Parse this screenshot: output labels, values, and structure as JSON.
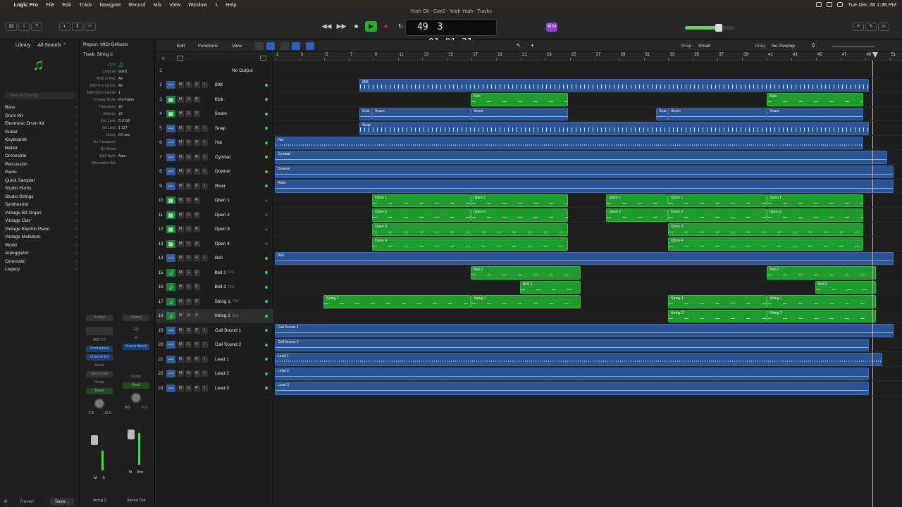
{
  "menubar": {
    "app": "Logic Pro",
    "items": [
      "File",
      "Edit",
      "Track",
      "Navigate",
      "Record",
      "Mix",
      "View",
      "Window",
      "1",
      "Help"
    ],
    "clock": "Tue Dec 28  1:36 PM"
  },
  "window": {
    "title": "Yeah Ok - Cue2 - Yeah Yeah - Tracks"
  },
  "lcd": {
    "bar": "49",
    "beat": "3",
    "time": "01:01:31",
    "sub": ""
  },
  "toolbar": {
    "badge": "⌘34"
  },
  "library": {
    "label": "Library",
    "filter": "All Sounds ⌃",
    "search_placeholder": "Search Sounds",
    "items": [
      "Bass",
      "Drum Kit",
      "Electronic Drum Kit",
      "Guitar",
      "Keyboards",
      "Mallet",
      "Orchestral",
      "Percussion",
      "Piano",
      "Quick Sampler",
      "Studio Horns",
      "Studio Strings",
      "Synthesizer",
      "Vintage B3 Organ",
      "Vintage Clav",
      "Vintage Electric Piano",
      "Vintage Mellotron",
      "World",
      "Arpeggiator",
      "Cinematic",
      "Legacy"
    ],
    "revert": "Revert",
    "save": "Save..."
  },
  "inspector": {
    "region": "Region:  MIDI Defaults",
    "track": "Track:  String 2",
    "icon_label": "Icon:",
    "rows": [
      {
        "l": "Channel:",
        "v": "Inst 8"
      },
      {
        "l": "MIDI In Port:",
        "v": "All"
      },
      {
        "l": "MIDI In Channel:",
        "v": "All"
      },
      {
        "l": "MIDI Out Channel:",
        "v": "1"
      },
      {
        "l": "Freeze Mode:",
        "v": "Pre Fader"
      },
      {
        "l": "Transpose:",
        "v": "±0"
      },
      {
        "l": "Velocity:",
        "v": "±0"
      },
      {
        "l": "Key Limit:",
        "v": "C-2  G8"
      },
      {
        "l": "Vel Limit:",
        "v": "1  127"
      },
      {
        "l": "Delay:",
        "v": "0.0 sec"
      },
      {
        "l": "No Transpose:",
        "v": ""
      },
      {
        "l": "No Reset:",
        "v": ""
      },
      {
        "l": "Staff Style:",
        "v": "Auto"
      },
      {
        "l": "Articulation Set:",
        "v": ""
      }
    ],
    "strip1": {
      "setting": "Setting",
      "plugin": "Omnisphere",
      "eq": "Channel EQ",
      "sends": "Sends",
      "out": "Stereo Out",
      "group": "Group",
      "read": "Read",
      "vol": "-7.0",
      "peak": "-12.9",
      "label": "String 2",
      "midi": "MIDI FX"
    },
    "strip2": {
      "setting": "Setting",
      "plugin": "Smack Attack",
      "eq": "EQ",
      "out": "",
      "group": "Group",
      "read": "Read",
      "vol": "0.0",
      "peak": "-0.1",
      "label": "Stereo Out",
      "bnc": "Bnc"
    }
  },
  "tracks_header": {
    "edit": "Edit",
    "functions": "Functions",
    "view": "View",
    "snap_label": "Snap:",
    "snap": "Smart",
    "drag_label": "Drag:",
    "drag": "No Overlap"
  },
  "ruler": {
    "bars": [
      "1",
      "3",
      "5",
      "7",
      "9",
      "11",
      "13",
      "15",
      "17",
      "19",
      "21",
      "23",
      "25",
      "27",
      "29",
      "31",
      "33",
      "35",
      "37",
      "39",
      "41",
      "43",
      "45",
      "47",
      "49",
      "51"
    ]
  },
  "tracks": [
    {
      "n": "1",
      "name": "No Output",
      "kind": "none"
    },
    {
      "n": "2",
      "name": "808",
      "kind": "audio"
    },
    {
      "n": "3",
      "name": "Kick",
      "kind": "drum"
    },
    {
      "n": "4",
      "name": "Snare",
      "kind": "drum"
    },
    {
      "n": "5",
      "name": "Snap",
      "kind": "audio"
    },
    {
      "n": "6",
      "name": "Hat",
      "kind": "audio"
    },
    {
      "n": "7",
      "name": "Cymbal",
      "kind": "audio"
    },
    {
      "n": "8",
      "name": "Downer",
      "kind": "audio"
    },
    {
      "n": "9",
      "name": "Riser",
      "kind": "audio"
    },
    {
      "n": "10",
      "name": "Open 1",
      "kind": "drum"
    },
    {
      "n": "11",
      "name": "Open 2",
      "kind": "drum"
    },
    {
      "n": "12",
      "name": "Open 3",
      "kind": "drum"
    },
    {
      "n": "13",
      "name": "Open 4",
      "kind": "drum"
    },
    {
      "n": "14",
      "name": "Bell",
      "kind": "audio"
    },
    {
      "n": "15",
      "name": "Bell 2",
      "kind": "inst",
      "ch": "Ch1"
    },
    {
      "n": "16",
      "name": "Bell 3",
      "kind": "inst",
      "ch": "Ch1"
    },
    {
      "n": "17",
      "name": "String 1",
      "kind": "inst",
      "ch": "Ch1"
    },
    {
      "n": "18",
      "name": "String 2",
      "kind": "inst",
      "ch": "Ch1",
      "sel": true
    },
    {
      "n": "19",
      "name": "Call Sound 1",
      "kind": "audio"
    },
    {
      "n": "20",
      "name": "Call Sound 2",
      "kind": "audio"
    },
    {
      "n": "21",
      "name": "Lead 1",
      "kind": "audio"
    },
    {
      "n": "22",
      "name": "Lead 2",
      "kind": "audio"
    },
    {
      "n": "23",
      "name": "Lead 3",
      "kind": "audio"
    }
  ],
  "regions": [
    {
      "t": 2,
      "s": 122,
      "e": 845,
      "name": "808",
      "k": "audio",
      "w": "dense"
    },
    {
      "t": 3,
      "s": 280,
      "e": 418,
      "name": "Kick",
      "k": "midi"
    },
    {
      "t": 3,
      "s": 700,
      "e": 837,
      "name": "Kick",
      "k": "midi"
    },
    {
      "t": 4,
      "s": 122,
      "e": 140,
      "name": "Snar",
      "k": "audio"
    },
    {
      "t": 4,
      "s": 140,
      "e": 280,
      "name": "Snare",
      "k": "audio"
    },
    {
      "t": 4,
      "s": 280,
      "e": 418,
      "name": "Snare",
      "k": "audio"
    },
    {
      "t": 4,
      "s": 543,
      "e": 560,
      "name": "Snar",
      "k": "audio"
    },
    {
      "t": 4,
      "s": 560,
      "e": 700,
      "name": "Snare",
      "k": "audio"
    },
    {
      "t": 4,
      "s": 700,
      "e": 837,
      "name": "Snare",
      "k": "audio"
    },
    {
      "t": 5,
      "s": 122,
      "e": 845,
      "name": "Snap",
      "k": "audio",
      "w": "dense"
    },
    {
      "t": 6,
      "s": 2,
      "e": 837,
      "name": "Hat",
      "k": "audio",
      "w": "hat"
    },
    {
      "t": 7,
      "s": 2,
      "e": 871,
      "name": "Cymbal",
      "k": "audio"
    },
    {
      "t": 8,
      "s": 2,
      "e": 880,
      "name": "Downer",
      "k": "audio"
    },
    {
      "t": 9,
      "s": 2,
      "e": 880,
      "name": "Riser",
      "k": "audio"
    },
    {
      "t": 10,
      "s": 140,
      "e": 280,
      "name": "Open 1",
      "k": "midi"
    },
    {
      "t": 10,
      "s": 280,
      "e": 418,
      "name": "Open 1",
      "k": "midi"
    },
    {
      "t": 10,
      "s": 472,
      "e": 560,
      "name": "Open 1",
      "k": "midi"
    },
    {
      "t": 10,
      "s": 560,
      "e": 700,
      "name": "Open 1",
      "k": "midi"
    },
    {
      "t": 10,
      "s": 700,
      "e": 837,
      "name": "Open 1",
      "k": "midi"
    },
    {
      "t": 11,
      "s": 140,
      "e": 280,
      "name": "Open 2",
      "k": "midi"
    },
    {
      "t": 11,
      "s": 280,
      "e": 418,
      "name": "Open 2",
      "k": "midi"
    },
    {
      "t": 11,
      "s": 472,
      "e": 560,
      "name": "Open 2",
      "k": "midi"
    },
    {
      "t": 11,
      "s": 560,
      "e": 700,
      "name": "Open 2",
      "k": "midi"
    },
    {
      "t": 11,
      "s": 700,
      "e": 837,
      "name": "Open 2",
      "k": "midi"
    },
    {
      "t": 12,
      "s": 140,
      "e": 418,
      "name": "Open 3",
      "k": "midi"
    },
    {
      "t": 12,
      "s": 560,
      "e": 837,
      "name": "Open 3",
      "k": "midi"
    },
    {
      "t": 13,
      "s": 140,
      "e": 418,
      "name": "Open 4",
      "k": "midi"
    },
    {
      "t": 13,
      "s": 560,
      "e": 837,
      "name": "Open 4",
      "k": "midi"
    },
    {
      "t": 14,
      "s": 2,
      "e": 880,
      "name": "Bell",
      "k": "audio"
    },
    {
      "t": 15,
      "s": 280,
      "e": 436,
      "name": "Bell 2",
      "k": "midi"
    },
    {
      "t": 15,
      "s": 700,
      "e": 855,
      "name": "Bell 2",
      "k": "midi"
    },
    {
      "t": 16,
      "s": 350,
      "e": 436,
      "name": "Bell 3",
      "k": "midi"
    },
    {
      "t": 16,
      "s": 769,
      "e": 855,
      "name": "Bell 3",
      "k": "midi"
    },
    {
      "t": 17,
      "s": 71,
      "e": 280,
      "name": "String 1",
      "k": "midi"
    },
    {
      "t": 17,
      "s": 280,
      "e": 436,
      "name": "String 1",
      "k": "midi"
    },
    {
      "t": 17,
      "s": 560,
      "e": 700,
      "name": "String 1",
      "k": "midi"
    },
    {
      "t": 17,
      "s": 700,
      "e": 855,
      "name": "String 1",
      "k": "midi"
    },
    {
      "t": 18,
      "s": 560,
      "e": 700,
      "name": "String 2",
      "k": "midi"
    },
    {
      "t": 18,
      "s": 700,
      "e": 855,
      "name": "String 2",
      "k": "midi"
    },
    {
      "t": 19,
      "s": 2,
      "e": 880,
      "name": "Call Sound 1",
      "k": "audio"
    },
    {
      "t": 20,
      "s": 2,
      "e": 845,
      "name": "Call Sound 2",
      "k": "audio"
    },
    {
      "t": 21,
      "s": 2,
      "e": 864,
      "name": "Lead 1",
      "k": "audio",
      "w": "hat"
    },
    {
      "t": 22,
      "s": 2,
      "e": 845,
      "name": "Lead 2",
      "k": "audio"
    },
    {
      "t": 23,
      "s": 2,
      "e": 845,
      "name": "Lead 3",
      "k": "audio"
    }
  ]
}
